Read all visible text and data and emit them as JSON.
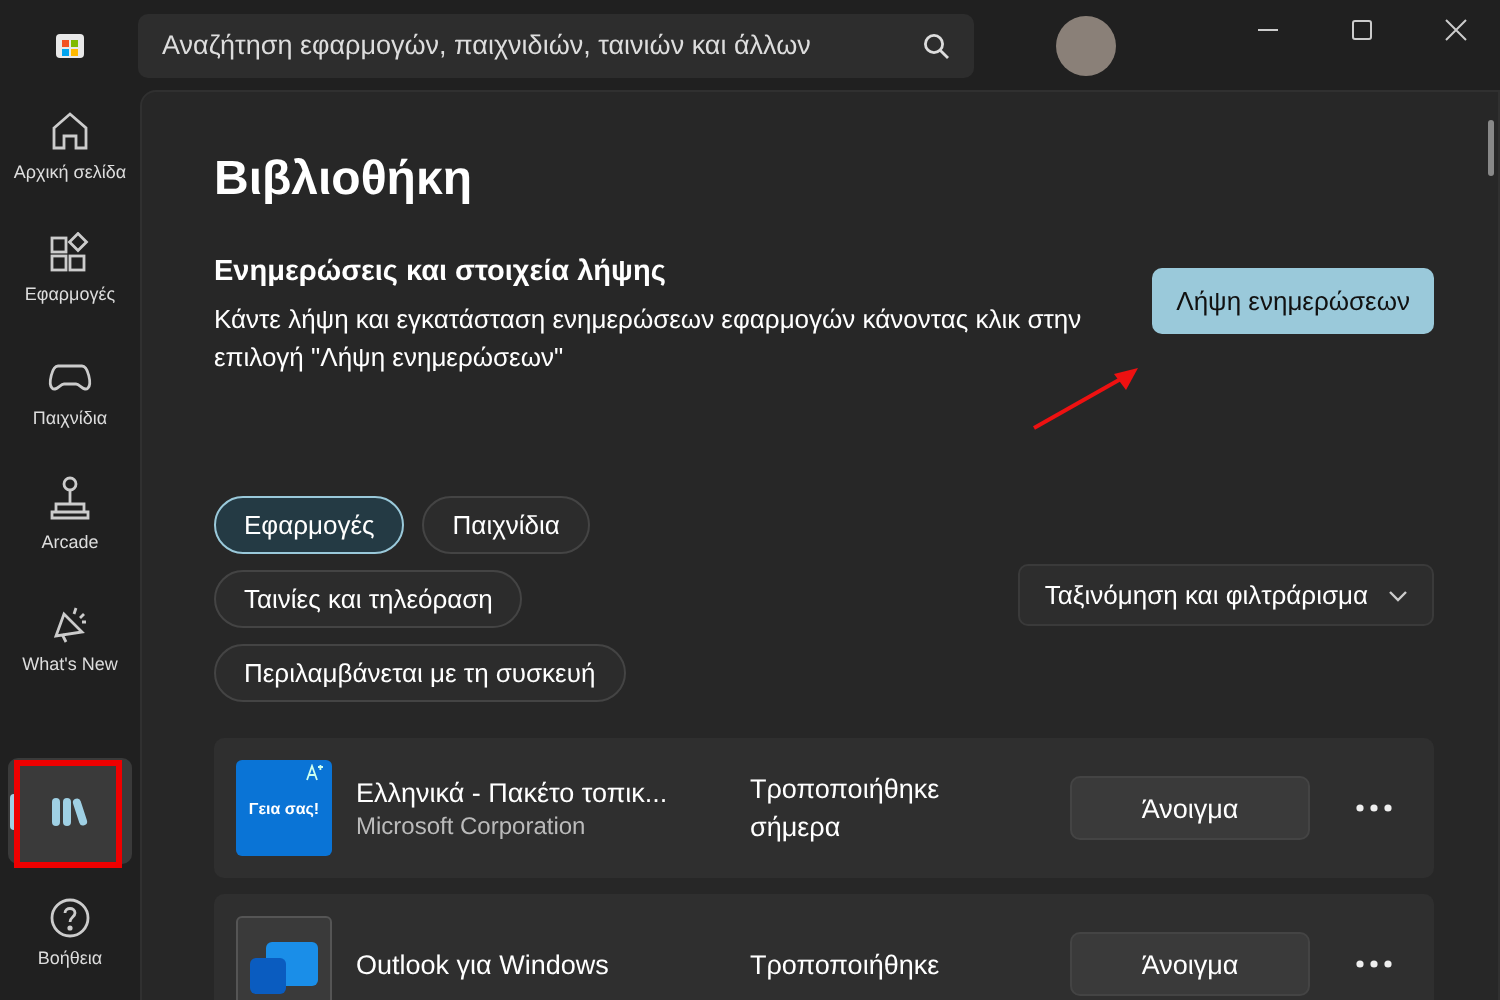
{
  "search": {
    "placeholder": "Αναζήτηση εφαρμογών, παιχνιδιών, ταινιών και άλλων"
  },
  "sidebar": {
    "items": [
      {
        "label": "Αρχική σελίδα",
        "kind": "home",
        "selected": false
      },
      {
        "label": "Εφαρμογές",
        "kind": "apps",
        "selected": false
      },
      {
        "label": "Παιχνίδια",
        "kind": "games",
        "selected": false
      },
      {
        "label": "Arcade",
        "kind": "arcade",
        "selected": false
      },
      {
        "label": "What's New",
        "kind": "news",
        "selected": false
      },
      {
        "kind": "library",
        "selected": true
      },
      {
        "label": "Βοήθεια",
        "kind": "help",
        "selected": false
      }
    ]
  },
  "page": {
    "title": "Βιβλιοθήκη",
    "updates": {
      "heading": "Ενημερώσεις και στοιχεία λήψης",
      "description": "Κάντε λήψη και εγκατάσταση ενημερώσεων εφαρμογών κάνοντας κλικ στην επιλογή \"Λήψη ενημερώσεων\"",
      "button": "Λήψη ενημερώσεων"
    },
    "filters": [
      {
        "label": "Εφαρμογές",
        "selected": true
      },
      {
        "label": "Παιχνίδια",
        "selected": false
      },
      {
        "label": "Ταινίες και τηλεόραση",
        "selected": false
      },
      {
        "label": "Περιλαμβάνεται με τη συσκευή",
        "selected": false
      }
    ],
    "sort": "Ταξινόμηση και φιλτράρισμα",
    "apps": [
      {
        "name": "Ελληνικά - Πακέτο τοπικ...",
        "publisher": "Microsoft Corporation",
        "status": "Τροποποιήθηκε σήμερα",
        "action": "Άνοιγμα",
        "kind": "language",
        "icon_text": "Γεια σας!"
      },
      {
        "name": "Outlook για Windows",
        "status": "Τροποποιήθηκε",
        "action": "Άνοιγμα",
        "kind": "mail"
      }
    ]
  }
}
